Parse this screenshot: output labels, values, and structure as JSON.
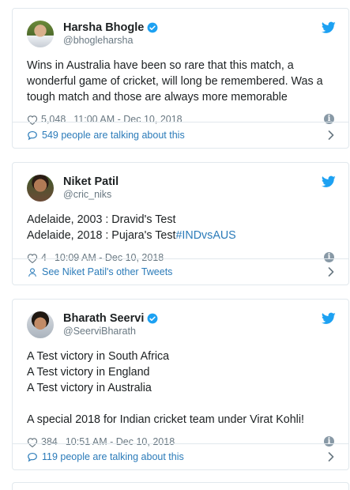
{
  "tweets": [
    {
      "name": "Harsha Bhogle",
      "handle": "@bhogleharsha",
      "verified": true,
      "text": "Wins in Australia have been so rare that this match, a wonderful game of cricket, will long be remembered. Was a tough match and those are always more memorable",
      "likes": "5,048",
      "timestamp": "11:00 AM - Dec 10, 2018",
      "footer": "549 people are talking about this",
      "footer_icon": "comment-icon"
    },
    {
      "name": "Niket Patil",
      "handle": "@cric_niks",
      "verified": false,
      "text_lines": [
        "Adelaide, 2003 : Dravid's Test",
        "Adelaide, 2018 : Pujara's Test"
      ],
      "hashtag": "#INDvsAUS",
      "likes": "4",
      "timestamp": "10:09 AM - Dec 10, 2018",
      "footer": "See Niket Patil's other Tweets",
      "footer_icon": "person-icon"
    },
    {
      "name": "Bharath Seervi",
      "handle": "@SeerviBharath",
      "verified": true,
      "text": "A Test victory in South Africa\nA Test victory in England\nA Test victory in Australia\n\nA special 2018 for Indian cricket team under Virat Kohli!",
      "likes": "384",
      "timestamp": "10:51 AM - Dec 10, 2018",
      "footer": "119 people are talking about this",
      "footer_icon": "comment-icon"
    }
  ],
  "colors": {
    "link": "#2b7bb9",
    "twitter_blue": "#1da1f2",
    "muted": "#697882",
    "border": "#e1e8ed"
  }
}
